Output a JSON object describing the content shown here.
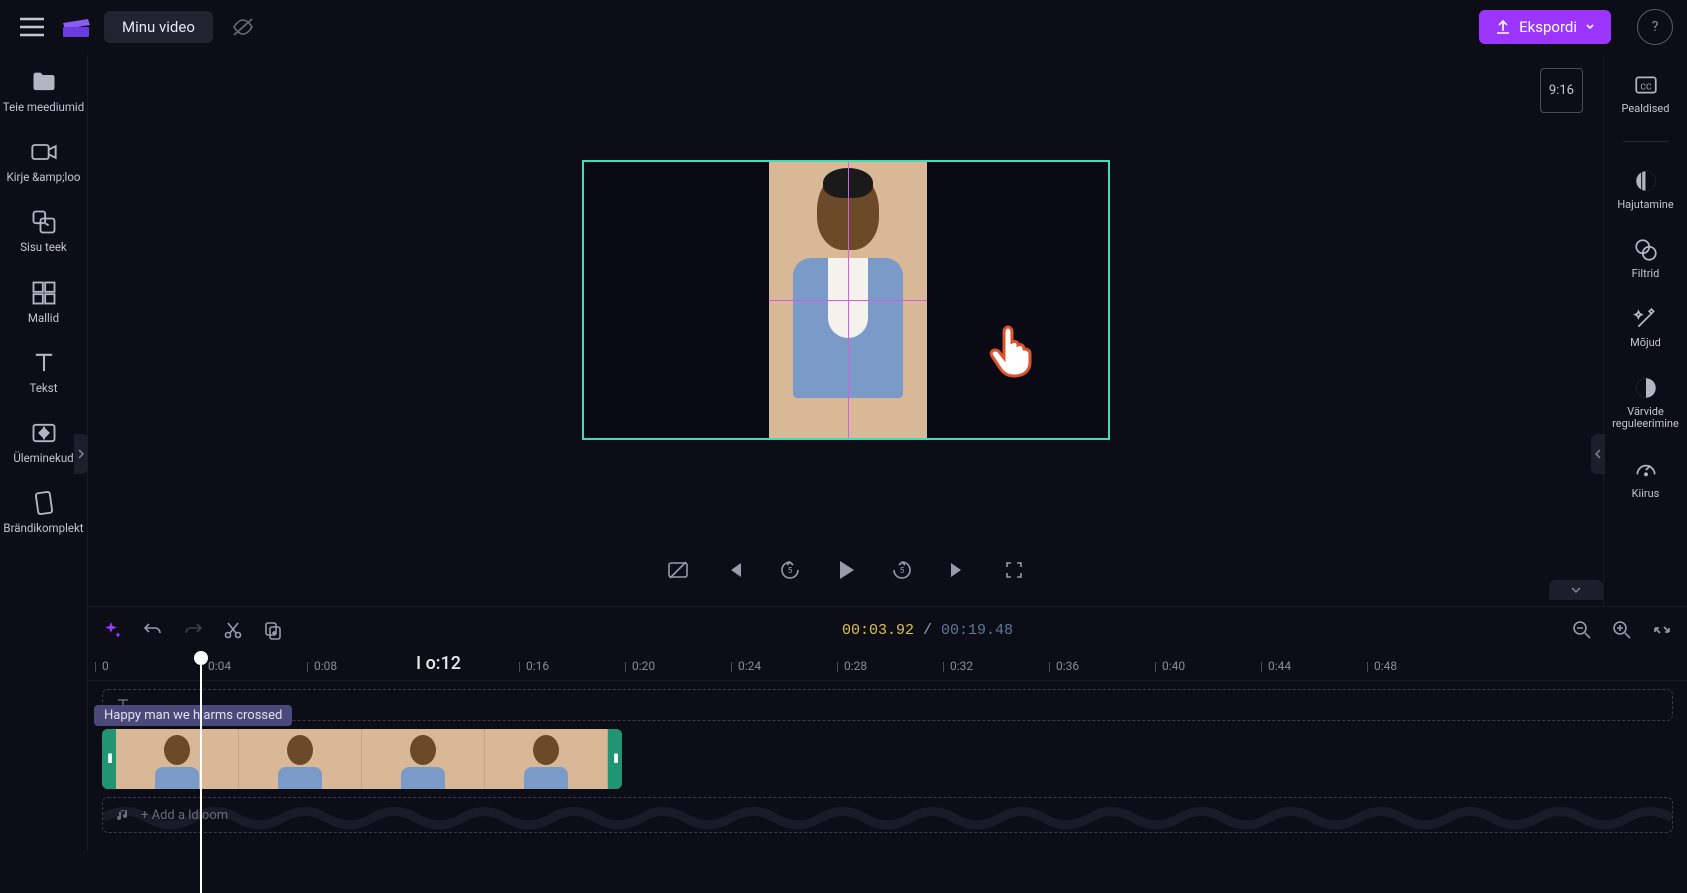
{
  "header": {
    "title": "Minu video",
    "export_label": "Ekspordi"
  },
  "left_sidebar": {
    "items": [
      {
        "label": "Teie meediumid"
      },
      {
        "label": "Kirje &amp;loo"
      },
      {
        "label": "Sisu teek"
      },
      {
        "label": "Mallid"
      },
      {
        "label": "Tekst"
      },
      {
        "label": "Üleminekud"
      },
      {
        "label": "Brändikomplekt"
      }
    ]
  },
  "right_sidebar": {
    "items": [
      {
        "label": "Pealdised"
      },
      {
        "label": "Hajutamine"
      },
      {
        "label": "Filtrid"
      },
      {
        "label": "Mõjud"
      },
      {
        "label": "Värvide reguleerimine"
      },
      {
        "label": "Kiirus"
      }
    ]
  },
  "preview": {
    "aspect_badge": "9:16"
  },
  "timeline": {
    "current_time": "00:03.92",
    "duration": "00:19.48",
    "separator": " / ",
    "focus_tick": "I o:12",
    "ticks": [
      "0",
      "0:04",
      "0:08",
      "",
      "0:16",
      "0:20",
      "0:24",
      "0:28",
      "0:32",
      "0:36",
      "0:40",
      "0:44",
      "0:48"
    ],
    "clip_tooltip": "Happy man we h arms crossed",
    "audio_placeholder": "+ Add a ldioom"
  }
}
